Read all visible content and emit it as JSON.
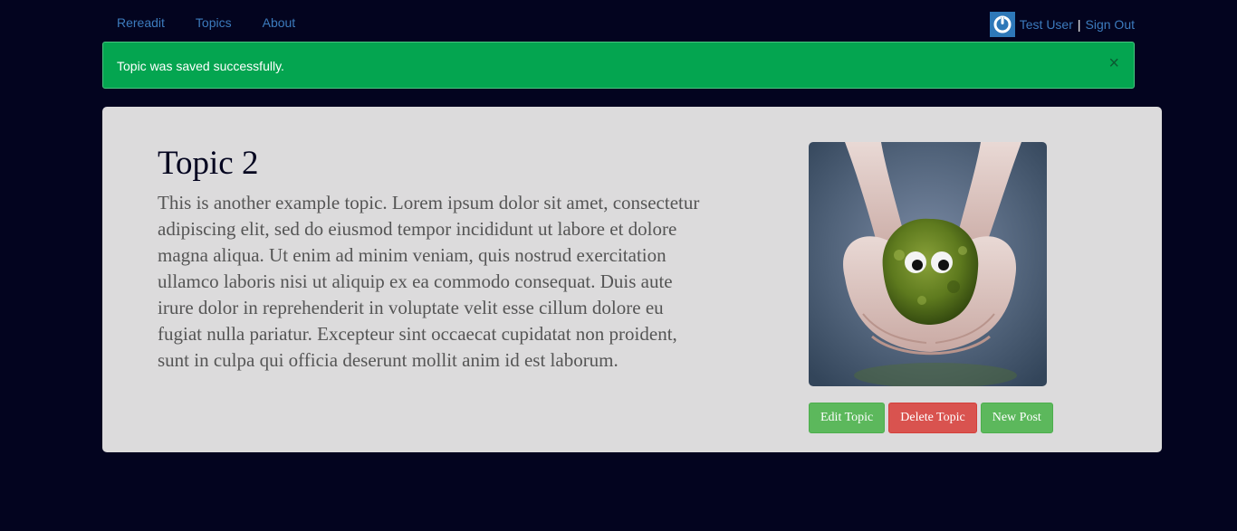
{
  "nav": {
    "brand": "Rereadit",
    "links": [
      "Topics",
      "About"
    ],
    "user_name": "Test User",
    "separator": "|",
    "sign_out": "Sign Out"
  },
  "alert": {
    "message": "Topic was saved successfully.",
    "close_symbol": "×",
    "color": "#04a550"
  },
  "topic": {
    "title": "Topic 2",
    "body": "This is another example topic. Lorem ipsum dolor sit amet, consectetur adipiscing elit, sed do eiusmod tempor incididunt ut labore et dolore magna aliqua. Ut enim ad minim veniam, quis nostrud exercitation ullamco laboris nisi ut aliquip ex ea commodo consequat. Duis aute irure dolor in reprehenderit in voluptate velit esse cillum dolore eu fugiat nulla pariatur. Excepteur sint occaecat cupidatat non proident, sunt in culpa qui officia deserunt mollit anim id est laborum."
  },
  "actions": {
    "edit": "Edit Topic",
    "delete": "Delete Topic",
    "new_post": "New Post"
  },
  "colors": {
    "background": "#03041f",
    "link": "#3c7bbd",
    "panel": "#dcdbdc",
    "success_button": "#5cb85c",
    "danger_button": "#d9534f"
  },
  "icons": {
    "avatar": "power-icon"
  }
}
